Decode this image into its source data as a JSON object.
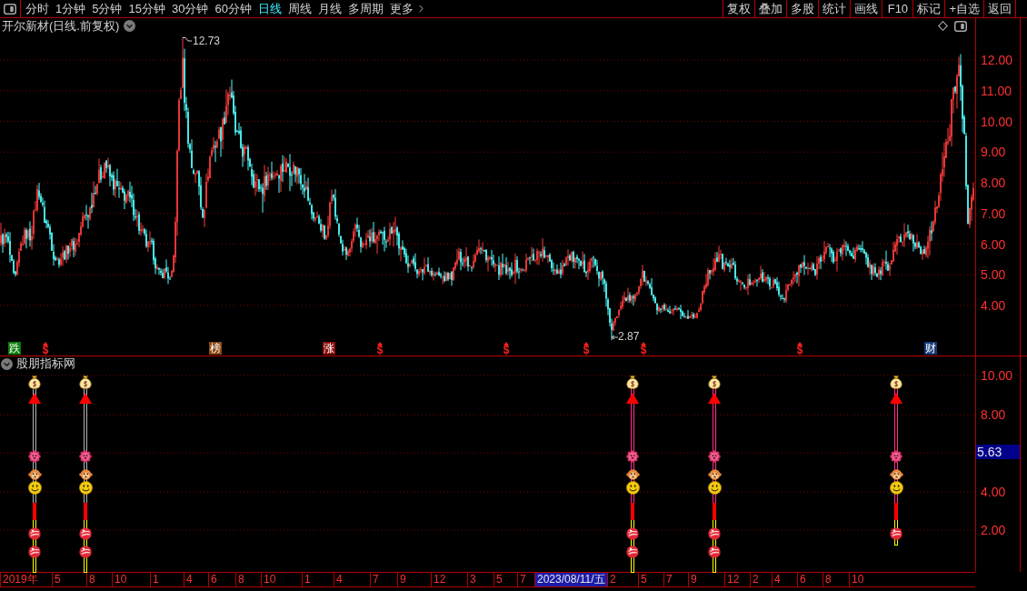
{
  "toolbar": {
    "periods": [
      {
        "label": "分时",
        "selected": false
      },
      {
        "label": "1分钟",
        "selected": false
      },
      {
        "label": "5分钟",
        "selected": false
      },
      {
        "label": "15分钟",
        "selected": false
      },
      {
        "label": "30分钟",
        "selected": false
      },
      {
        "label": "60分钟",
        "selected": false
      },
      {
        "label": "日线",
        "selected": true
      },
      {
        "label": "周线",
        "selected": false
      },
      {
        "label": "月线",
        "selected": false
      },
      {
        "label": "多周期",
        "selected": false
      }
    ],
    "more": "更多",
    "actions": [
      "复权",
      "叠加",
      "多股",
      "统计",
      "画线",
      "F10",
      "标记",
      "+自选",
      "返回"
    ]
  },
  "main_chart": {
    "title": "开尔新材(日线.前复权)",
    "price_axis": [
      "12.00",
      "11.00",
      "10.00",
      "9.00",
      "8.00",
      "7.00",
      "6.00",
      "5.00",
      "4.00"
    ],
    "high_label": "12.73",
    "low_label": "2.87",
    "event_marks": [
      {
        "kind": "tag",
        "text": "跌",
        "color": "#0a7d0a"
      },
      {
        "kind": "dollar",
        "text": "$"
      },
      {
        "kind": "tag",
        "text": "榜",
        "color": "#8a4712"
      },
      {
        "kind": "tag",
        "text": "涨",
        "color": "#8c0f0f"
      },
      {
        "kind": "dollar",
        "text": "$"
      },
      {
        "kind": "dollar",
        "text": "$"
      },
      {
        "kind": "dollar",
        "text": "$"
      },
      {
        "kind": "dollar",
        "text": "$"
      },
      {
        "kind": "dollar",
        "text": "$"
      },
      {
        "kind": "tag",
        "text": "财",
        "color": "#173a78"
      }
    ]
  },
  "indicator": {
    "title": "股朋指标网",
    "axis": [
      "10.00",
      "8.00",
      "4.00",
      "2.00"
    ],
    "current_value": "5.63",
    "signals": [
      {
        "color": "#b4b4b4",
        "second_ball": true
      },
      {
        "color": "#b4b4b4",
        "second_ball": true
      },
      {
        "color": "#ff2d8c",
        "second_ball": true
      },
      {
        "color": "#ff2d8c",
        "second_ball": true
      },
      {
        "color": "#ff2d8c",
        "second_ball": false
      }
    ]
  },
  "date_axis": [
    {
      "label": "2019年",
      "highlighted": false
    },
    {
      "label": "5",
      "highlighted": false
    },
    {
      "label": "8",
      "highlighted": false
    },
    {
      "label": "10",
      "highlighted": false
    },
    {
      "label": "1",
      "highlighted": false
    },
    {
      "label": "4",
      "highlighted": false
    },
    {
      "label": "6",
      "highlighted": false
    },
    {
      "label": "8",
      "highlighted": false
    },
    {
      "label": "10",
      "highlighted": false
    },
    {
      "label": "1",
      "highlighted": false
    },
    {
      "label": "4",
      "highlighted": false
    },
    {
      "label": "7",
      "highlighted": false
    },
    {
      "label": "9",
      "highlighted": false
    },
    {
      "label": "12",
      "highlighted": false
    },
    {
      "label": "3",
      "highlighted": false
    },
    {
      "label": "5",
      "highlighted": false
    },
    {
      "label": "7",
      "highlighted": false
    },
    {
      "label": "2023/08/11/五",
      "highlighted": true
    },
    {
      "label": "2",
      "highlighted": false
    },
    {
      "label": "5",
      "highlighted": false
    },
    {
      "label": "7",
      "highlighted": false
    },
    {
      "label": "9",
      "highlighted": false
    },
    {
      "label": "12",
      "highlighted": false
    },
    {
      "label": "2",
      "highlighted": false
    },
    {
      "label": "4",
      "highlighted": false
    },
    {
      "label": "6",
      "highlighted": false
    },
    {
      "label": "8",
      "highlighted": false
    },
    {
      "label": "10",
      "highlighted": false
    }
  ]
}
